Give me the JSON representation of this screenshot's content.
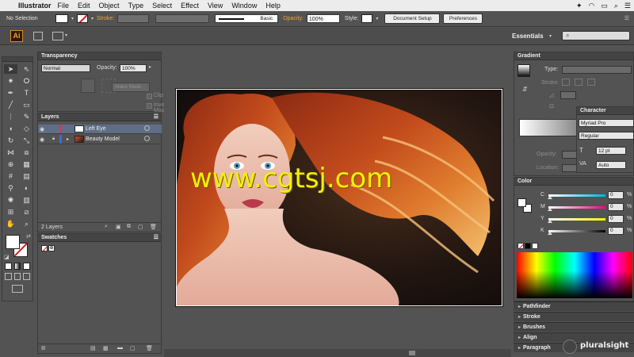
{
  "menubar": {
    "app_name": "Illustrator",
    "items": [
      "File",
      "Edit",
      "Object",
      "Type",
      "Select",
      "Effect",
      "View",
      "Window",
      "Help"
    ]
  },
  "controlbar": {
    "selection": "No Selection",
    "stroke_label": "Stroke:",
    "stroke_style": "Basic",
    "opacity_label": "Opacity:",
    "opacity_value": "100%",
    "style_label": "Style:",
    "document_setup": "Document Setup",
    "preferences": "Preferences"
  },
  "appbar": {
    "logo": "Ai",
    "workspace": "Essentials"
  },
  "transparency": {
    "title": "Transparency",
    "blend_mode": "Normal",
    "opacity_label": "Opacity:",
    "opacity_value": "100%",
    "make_mask": "Make Mask",
    "clip": "Clip",
    "invert_mask": "Invert Mask"
  },
  "layers": {
    "title": "Layers",
    "rows": [
      {
        "name": "Left Eye"
      },
      {
        "name": "Beauty Model"
      }
    ],
    "count": "2 Layers"
  },
  "swatches": {
    "title": "Swatches"
  },
  "gradient": {
    "title": "Gradient",
    "type_label": "Type:",
    "stroke_label": "Stroke:",
    "opacity_label": "Opacity:",
    "location_label": "Location:"
  },
  "character": {
    "title": "Character",
    "font": "Myriad Pro",
    "style": "Regular",
    "size": "12 pt",
    "tracking": "Auto"
  },
  "color": {
    "title": "Color",
    "channels": [
      {
        "label": "C",
        "value": "0",
        "track": "linear-gradient(to right,#fff,#00aeef)"
      },
      {
        "label": "M",
        "value": "0",
        "track": "linear-gradient(to right,#fff,#ec008c)"
      },
      {
        "label": "Y",
        "value": "0",
        "track": "linear-gradient(to right,#fff,#fff200)"
      },
      {
        "label": "K",
        "value": "0",
        "track": "linear-gradient(to right,#fff,#000)"
      }
    ],
    "percent": "%"
  },
  "collapsed_panels": [
    "Pathfinder",
    "Stroke",
    "Brushes",
    "Align",
    "Paragraph"
  ],
  "watermark": "www.cgtsj.com",
  "brand": "pluralsight"
}
